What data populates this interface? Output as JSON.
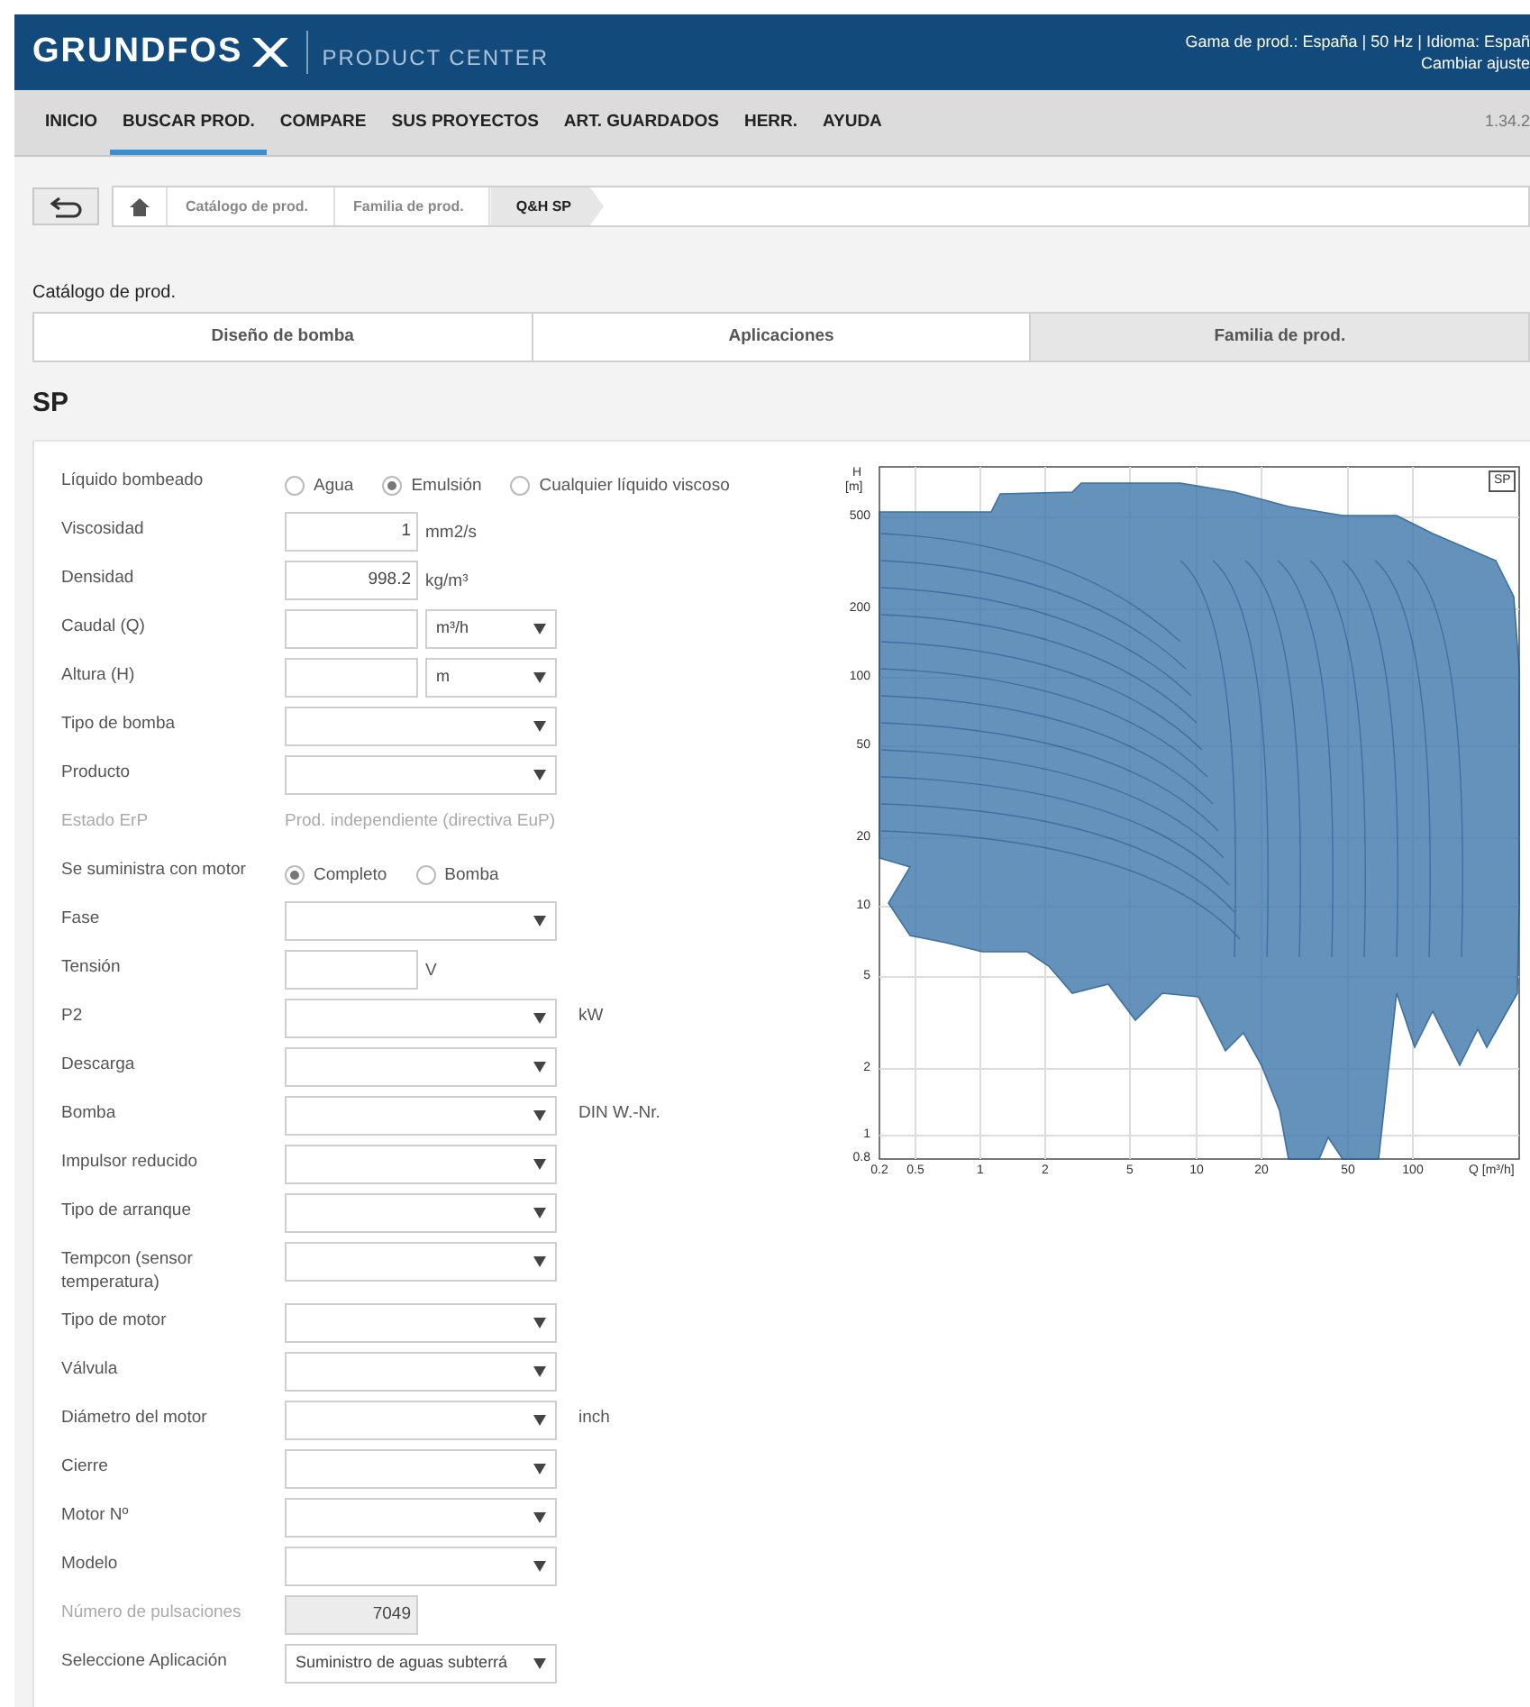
{
  "header": {
    "logo_text": "GRUNDFOS",
    "product": "PRODUCT CENTER",
    "settings_line": "Gama de prod.: España | 50 Hz | Idioma: Españ",
    "settings_link": "Cambiar ajuste"
  },
  "nav": {
    "items": [
      {
        "label": "INICIO",
        "selected": false
      },
      {
        "label": "BUSCAR PROD.",
        "selected": true
      },
      {
        "label": "COMPARE",
        "selected": false
      },
      {
        "label": "SUS PROYECTOS",
        "selected": false
      },
      {
        "label": "ART. GUARDADOS",
        "selected": false
      },
      {
        "label": "HERR.",
        "selected": false
      },
      {
        "label": "AYUDA",
        "selected": false
      }
    ],
    "version": "1.34.2"
  },
  "breadcrumb": [
    {
      "label": "Catálogo de prod.",
      "selected": false
    },
    {
      "label": "Familia de prod.",
      "selected": false
    },
    {
      "label": "Q&H SP",
      "selected": true
    }
  ],
  "section_label": "Catálogo de prod.",
  "tabs": [
    {
      "label": "Diseño de bomba",
      "selected": false
    },
    {
      "label": "Aplicaciones",
      "selected": false
    },
    {
      "label": "Familia de prod.",
      "selected": true
    }
  ],
  "title": "SP",
  "form": [
    {
      "kind": "radio",
      "label": "Líquido bombeado",
      "disabled": false,
      "options": [
        {
          "label": "Agua",
          "selected": false
        },
        {
          "label": "Emulsión",
          "selected": true
        },
        {
          "label": "Cualquier líquido viscoso",
          "selected": false
        }
      ]
    },
    {
      "kind": "input",
      "label": "Viscosidad",
      "disabled": false,
      "value": "1",
      "unit": "mm2/s"
    },
    {
      "kind": "input",
      "label": "Densidad",
      "disabled": false,
      "value": "998.2",
      "unit": "kg/m³"
    },
    {
      "kind": "input_select",
      "label": "Caudal (Q)",
      "disabled": false,
      "select_value": "m³/h"
    },
    {
      "kind": "input_select",
      "label": "Altura (H)",
      "disabled": false,
      "select_value": "m"
    },
    {
      "kind": "select",
      "label": "Tipo de bomba",
      "disabled": false
    },
    {
      "kind": "select",
      "label": "Producto",
      "disabled": false
    },
    {
      "kind": "static",
      "label": "Estado ErP",
      "disabled": true,
      "value": "Prod. independiente (directiva EuP)"
    },
    {
      "kind": "radio",
      "label": "Se suministra con motor",
      "disabled": false,
      "options": [
        {
          "label": "Completo",
          "selected": true
        },
        {
          "label": "Bomba",
          "selected": false
        }
      ]
    },
    {
      "kind": "select",
      "label": "Fase",
      "disabled": false
    },
    {
      "kind": "input",
      "label": "Tensión",
      "disabled": false,
      "unit": "V"
    },
    {
      "kind": "select",
      "label": "P2",
      "disabled": false,
      "unit": "kW"
    },
    {
      "kind": "select",
      "label": "Descarga",
      "disabled": false
    },
    {
      "kind": "select",
      "label": "Bomba",
      "disabled": false,
      "unit": "DIN W.-Nr."
    },
    {
      "kind": "select",
      "label": "Impulsor reducido",
      "disabled": false
    },
    {
      "kind": "select",
      "label": "Tipo de arranque",
      "disabled": false
    },
    {
      "kind": "select",
      "label": "Tempcon (sensor temperatura)",
      "disabled": false
    },
    {
      "kind": "select",
      "label": "Tipo de motor",
      "disabled": false
    },
    {
      "kind": "select",
      "label": "Válvula",
      "disabled": false
    },
    {
      "kind": "select",
      "label": "Diámetro del motor",
      "disabled": false,
      "unit": "inch"
    },
    {
      "kind": "select",
      "label": "Cierre",
      "disabled": false
    },
    {
      "kind": "select",
      "label": "Motor Nº",
      "disabled": false
    },
    {
      "kind": "select",
      "label": "Modelo",
      "disabled": false
    },
    {
      "kind": "input",
      "label": "Número de pulsaciones",
      "disabled": true,
      "value": "7049"
    },
    {
      "kind": "select",
      "label": "Seleccione Aplicación",
      "disabled": false,
      "value": "Suministro de aguas subterrá"
    }
  ],
  "chart": {
    "y_title": "H",
    "y_unit": "[m]",
    "legend": "SP",
    "x_title": "Q [m³/h]",
    "y_ticks": [
      "500",
      "200",
      "100",
      "50",
      "20",
      "10",
      "5",
      "2",
      "1",
      "0.8"
    ],
    "x_ticks": [
      "0.2",
      "0.5",
      "1",
      "2",
      "5",
      "10",
      "20",
      "50",
      "100"
    ]
  }
}
